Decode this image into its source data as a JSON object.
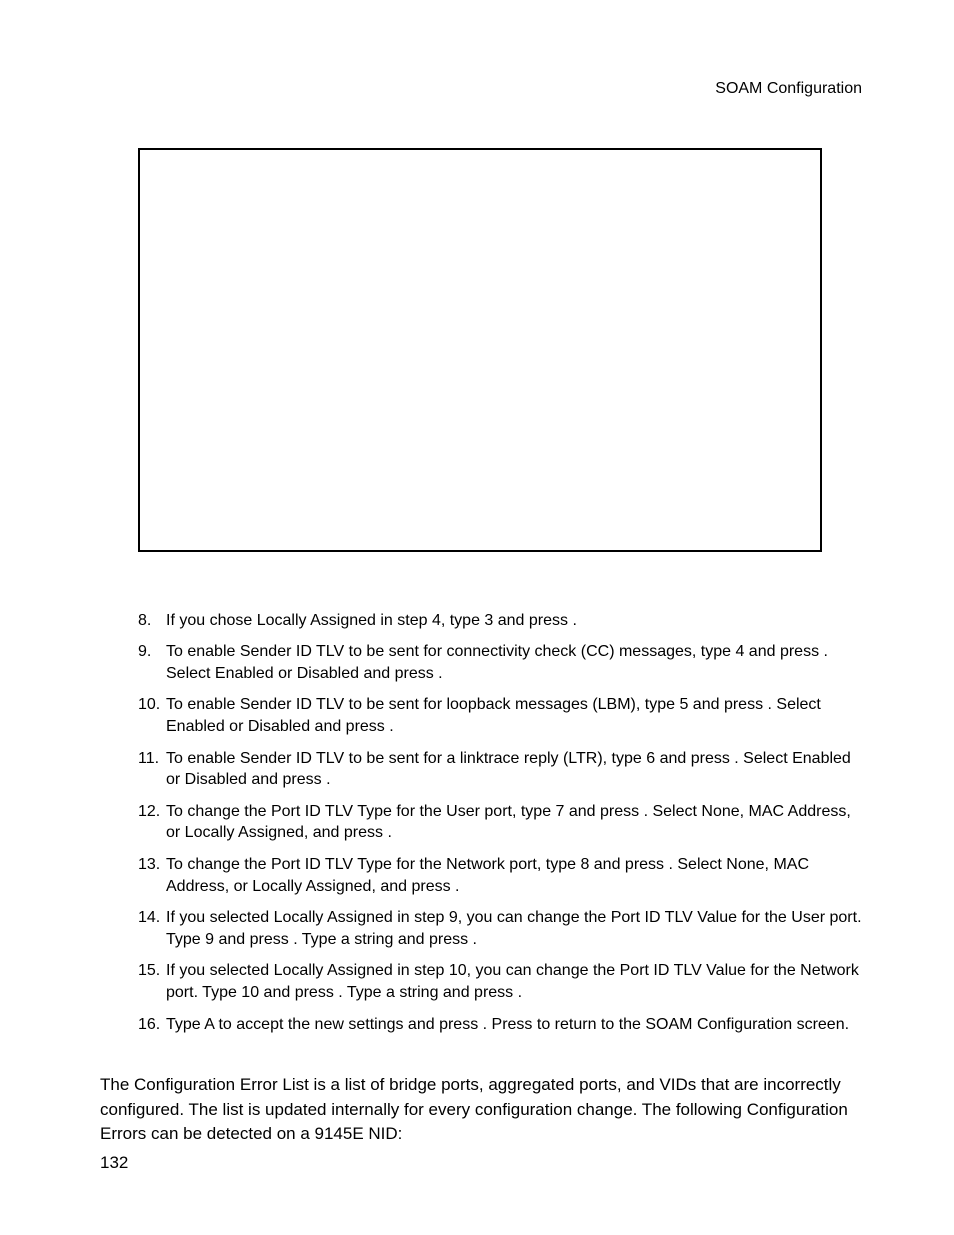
{
  "header": {
    "running": "SOAM Configuration"
  },
  "steps": [
    {
      "n": "8.",
      "text": "If you chose Locally Assigned in step 4, type 3 and press        ."
    },
    {
      "n": "9.",
      "text": "To enable Sender ID TLV to be sent for connectivity check (CC) messages, type 4 and press        . Select Enabled or Disabled and press        ."
    },
    {
      "n": "10.",
      "text": "To enable Sender ID TLV to be sent for loopback messages (LBM), type 5 and press        . Select Enabled or Disabled and press        ."
    },
    {
      "n": "11.",
      "text": "To enable Sender ID TLV to be sent for a linktrace reply (LTR), type 6 and press        . Select Enabled or Disabled and press        ."
    },
    {
      "n": "12.",
      "text": "To change the Port ID TLV Type for the User port, type 7 and press        . Select None, MAC Address, or Locally Assigned, and press        ."
    },
    {
      "n": "13.",
      "text": "To change the Port ID TLV Type for the Network port, type 8 and press        . Select None, MAC Address, or Locally Assigned, and press        ."
    },
    {
      "n": "14.",
      "text": "If you selected Locally Assigned in step 9, you can change the Port ID TLV Value for the User port. Type 9 and press        . Type a string and press        ."
    },
    {
      "n": "15.",
      "text": "If you selected Locally Assigned in step 10, you can change the Port ID TLV Value for the Network port. Type 10 and press        . Type a string and press        ."
    },
    {
      "n": "16.",
      "text": "Type A to accept the new settings and press        . Press       to return to the SOAM Configuration screen."
    }
  ],
  "body": {
    "para1": "The Configuration Error List is a list of bridge ports, aggregated ports, and VIDs that are incorrectly configured. The list is updated internally for every configuration change. The following Configuration Errors can be detected on a 9145E NID:"
  },
  "page_number": "132"
}
